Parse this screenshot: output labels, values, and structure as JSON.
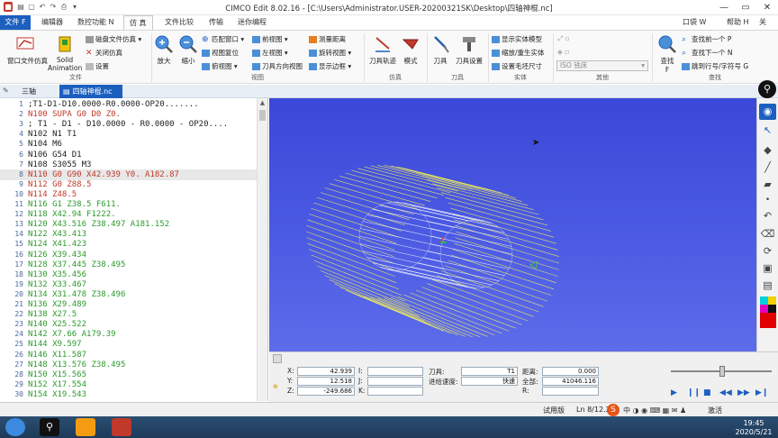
{
  "window": {
    "title": "CIMCO Edit 8.02.16 - [C:\\Users\\Administrator.USER-20200321SK\\Desktop\\四轴神棍.nc]",
    "minimize": "—",
    "maximize": "▭",
    "close": "✕"
  },
  "menu": {
    "file": "文件 F",
    "tabs": [
      "编辑器",
      "数控功能 N",
      "仿 真",
      "文件比较",
      "传输",
      "迷你编程"
    ],
    "right": [
      "口袋 W",
      "帮助 H",
      "关于"
    ]
  },
  "ribbon": {
    "groups": {
      "file": "文件",
      "view": "视图",
      "simulate": "仿真",
      "tool": "刀具",
      "solid": "实体",
      "other": "其他",
      "find": "查找"
    },
    "window_sim": "窗口文件仿真",
    "solid_anim": "Solid",
    "solid_anim2": "Animation",
    "disk_sim": "磁盘文件仿真",
    "close_sim": "关闭仿真",
    "settings": "设置",
    "zoom_in": "放大",
    "zoom_out": "缩小",
    "fit_window": "匹配窗口",
    "reset_view": "视图复位",
    "top_view": "俯视图",
    "front_view": "前视图",
    "left_view": "左视图",
    "tool_view": "刀具方向视图",
    "measure": "测量距离",
    "rotate_view": "旋转视图",
    "show_outline": "显示边框",
    "toolpath": "刀具轨迹",
    "mode": "模式",
    "tool": "刀具",
    "tool_settings": "刀具设置",
    "show_solid": "显示实体模型",
    "cut_solid": "缩放/重生实体",
    "set_blank": "设置毛坯尺寸",
    "machine_select": "ISO 铣床",
    "find": "查找",
    "find_label": "F",
    "find_prev": "查找前一个 P",
    "find_next": "查找下一个 N",
    "goto_line": "跳到行号/字符号 G"
  },
  "doc_tabs": [
    "三轴",
    "四轴神棍.nc"
  ],
  "code_lines": [
    {
      "n": "1",
      "text": ";T1-D1-D10.0000-R0.0000-OP20.......",
      "color": "#222222"
    },
    {
      "n": "2",
      "text": "N100 SUPA G0 D0 Z0.",
      "color": "#c0392b"
    },
    {
      "n": "3",
      "text": "; T1 - D1 - D10.0000 - R0.0000 - OP20....",
      "color": "#222222"
    },
    {
      "n": "4",
      "text": "N102 N1 T1",
      "color": "#222222"
    },
    {
      "n": "5",
      "text": "N104 M6",
      "color": "#222222"
    },
    {
      "n": "6",
      "text": "N106 G54 D1",
      "color": "#222222"
    },
    {
      "n": "7",
      "text": "N108 S3055 M3",
      "color": "#222222"
    },
    {
      "n": "8",
      "text": "N110 G0 G90 X42.939 Y0. A182.87",
      "color": "#c0392b"
    },
    {
      "n": "9",
      "text": "N112 G0 Z88.5",
      "color": "#c0392b"
    },
    {
      "n": "10",
      "text": "N114 Z48.5",
      "color": "#c0392b"
    },
    {
      "n": "11",
      "text": "N116 G1 Z38.5 F611.",
      "color": "#2e9a2e"
    },
    {
      "n": "12",
      "text": "N118 X42.94 F1222.",
      "color": "#2e9a2e"
    },
    {
      "n": "13",
      "text": "N120 X43.516 Z38.497 A181.152",
      "color": "#2e9a2e"
    },
    {
      "n": "14",
      "text": "N122 X43.413",
      "color": "#2e9a2e"
    },
    {
      "n": "15",
      "text": "N124 X41.423",
      "color": "#2e9a2e"
    },
    {
      "n": "16",
      "text": "N126 X39.434",
      "color": "#2e9a2e"
    },
    {
      "n": "17",
      "text": "N128 X37.445 Z38.495",
      "color": "#2e9a2e"
    },
    {
      "n": "18",
      "text": "N130 X35.456",
      "color": "#2e9a2e"
    },
    {
      "n": "19",
      "text": "N132 X33.467",
      "color": "#2e9a2e"
    },
    {
      "n": "20",
      "text": "N134 X31.478 Z38.496",
      "color": "#2e9a2e"
    },
    {
      "n": "21",
      "text": "N136 X29.489",
      "color": "#2e9a2e"
    },
    {
      "n": "22",
      "text": "N138 X27.5",
      "color": "#2e9a2e"
    },
    {
      "n": "23",
      "text": "N140 X25.522",
      "color": "#2e9a2e"
    },
    {
      "n": "24",
      "text": "N142 X7.66 A179.39",
      "color": "#2e9a2e"
    },
    {
      "n": "25",
      "text": "N144 X9.597",
      "color": "#2e9a2e"
    },
    {
      "n": "26",
      "text": "N146 X11.587",
      "color": "#2e9a2e"
    },
    {
      "n": "27",
      "text": "N148 X13.576 Z38.495",
      "color": "#2e9a2e"
    },
    {
      "n": "28",
      "text": "N150 X15.565",
      "color": "#2e9a2e"
    },
    {
      "n": "29",
      "text": "N152 X17.554",
      "color": "#2e9a2e"
    },
    {
      "n": "30",
      "text": "N154 X19.543",
      "color": "#2e9a2e"
    }
  ],
  "sim": {
    "x_label": "X:",
    "y_label": "Y:",
    "z_label": "Z:",
    "x_val": "42.939",
    "y_val": "12.518",
    "z_val": "-249.686",
    "i_label": "I:",
    "j_label": "J:",
    "k_label": "K:",
    "tool_label": "刀具:",
    "tool_val": "T1",
    "feed_label": "进给速度:",
    "feed_val": "快速",
    "dist_label": "距离:",
    "dist_val": "0.000",
    "total_label": "全部:",
    "total_val": "41046.116",
    "r_label": "R:"
  },
  "status": {
    "mode": "试用版",
    "position": "Ln 8/12.2",
    "state": "激活"
  },
  "taskbar": {
    "time": "19:45",
    "date": "2020/5/21"
  }
}
